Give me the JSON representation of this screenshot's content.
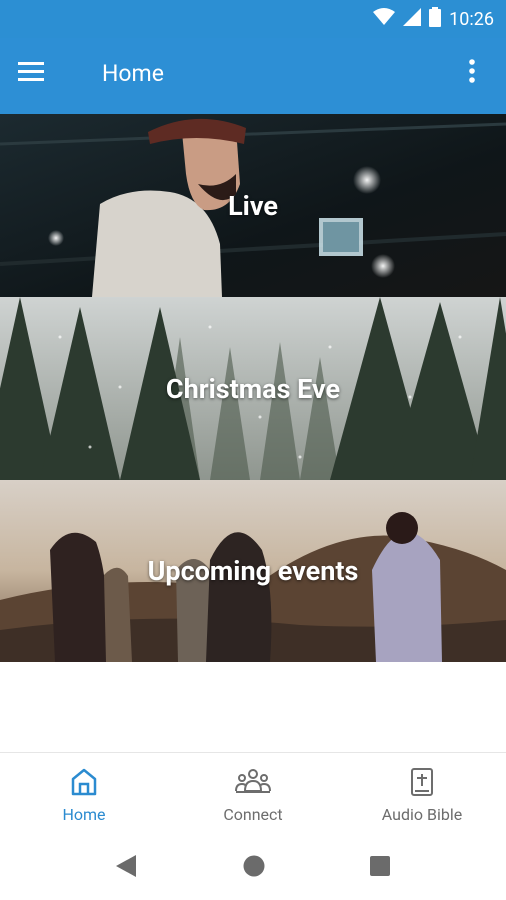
{
  "status_bar": {
    "time": "10:26"
  },
  "header": {
    "title": "Home"
  },
  "cards": [
    {
      "label": "Live"
    },
    {
      "label": "Christmas Eve"
    },
    {
      "label": "Upcoming events"
    }
  ],
  "bottom_nav": {
    "items": [
      {
        "label": "Home",
        "icon": "home-icon",
        "active": true
      },
      {
        "label": "Connect",
        "icon": "people-icon",
        "active": false
      },
      {
        "label": "Audio Bible",
        "icon": "bible-icon",
        "active": false
      }
    ]
  },
  "colors": {
    "brand": "#2d8fd5",
    "active_nav": "#2b8bd0",
    "inactive_nav": "#6d6d6d"
  }
}
